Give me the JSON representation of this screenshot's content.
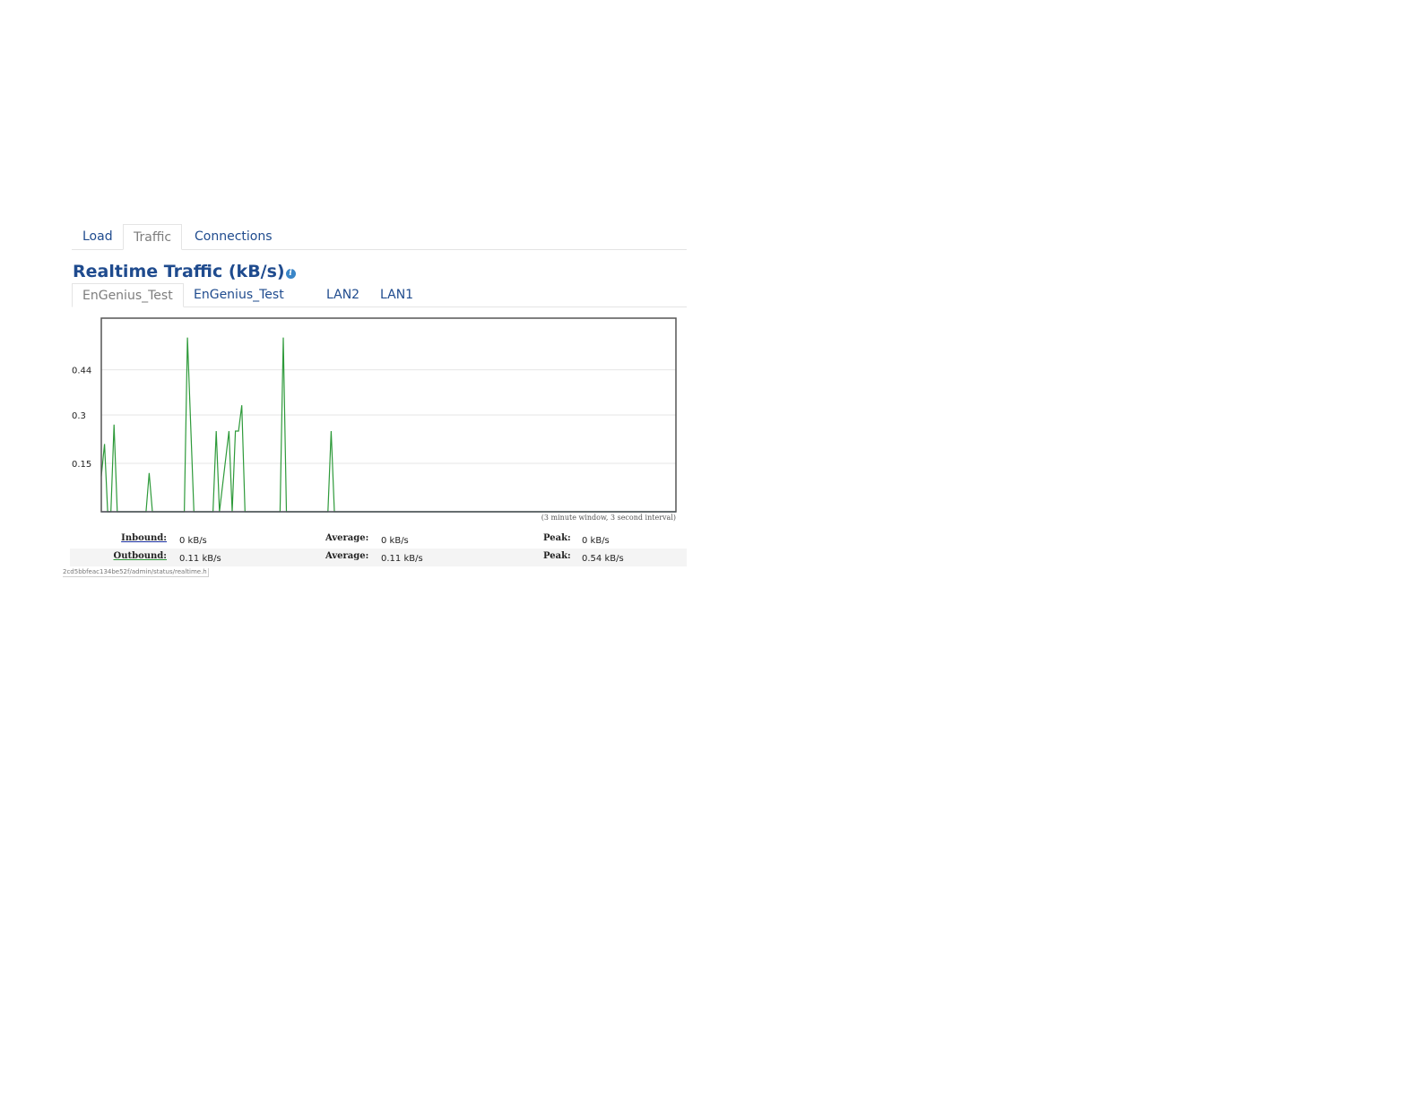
{
  "top_tabs": [
    {
      "label": "Load",
      "active": false
    },
    {
      "label": "Traffic",
      "active": true
    },
    {
      "label": "Connections",
      "active": false
    }
  ],
  "section": {
    "title": "Realtime Traffic (kB/s)",
    "info_icon": "info-icon"
  },
  "interface_tabs": [
    {
      "label": "EnGenius_Test",
      "active": true
    },
    {
      "label": "EnGenius_Test",
      "active": false
    },
    {
      "label": "LAN2",
      "active": false
    },
    {
      "label": "LAN1",
      "active": false
    }
  ],
  "chart_data": {
    "type": "line",
    "y_ticks": [
      "0.44",
      "0.3",
      "0.15"
    ],
    "y_tick_values": [
      0.44,
      0.3,
      0.15
    ],
    "ylim": [
      0,
      0.6
    ],
    "xlim": [
      0,
      180
    ],
    "grid": true,
    "note": "(3 minute window, 3 second interval)",
    "series": [
      {
        "name": "Outbound",
        "color": "#2e9a3a",
        "points": [
          [
            0,
            0.11
          ],
          [
            1,
            0.21
          ],
          [
            2,
            0
          ],
          [
            3,
            0
          ],
          [
            4,
            0.27
          ],
          [
            5,
            0
          ],
          [
            14,
            0
          ],
          [
            15,
            0.12
          ],
          [
            16,
            0
          ],
          [
            26,
            0
          ],
          [
            27,
            0.54
          ],
          [
            29,
            0
          ],
          [
            35,
            0
          ],
          [
            36,
            0.25
          ],
          [
            37,
            0
          ],
          [
            40,
            0.25
          ],
          [
            41,
            0
          ],
          [
            42,
            0.25
          ],
          [
            43,
            0.25
          ],
          [
            44,
            0.33
          ],
          [
            45,
            0
          ],
          [
            56,
            0
          ],
          [
            57,
            0.54
          ],
          [
            58,
            0
          ],
          [
            71,
            0
          ],
          [
            72,
            0.25
          ],
          [
            73,
            0
          ],
          [
            180,
            0
          ]
        ]
      },
      {
        "name": "Inbound",
        "color": "#1a2fa0",
        "points": [
          [
            0,
            0
          ],
          [
            180,
            0
          ]
        ]
      }
    ]
  },
  "stats": {
    "inbound": {
      "label": "Inbound:",
      "value": "0 kB/s",
      "avg_label": "Average:",
      "avg": "0 kB/s",
      "peak_label": "Peak:",
      "peak": "0 kB/s"
    },
    "outbound": {
      "label": "Outbound:",
      "value": "0.11 kB/s",
      "avg_label": "Average:",
      "avg": "0.11 kB/s",
      "peak_label": "Peak:",
      "peak": "0.54 kB/s"
    }
  },
  "status_url": "2cd5bbfeac134be52f/admin/status/realtime.h"
}
